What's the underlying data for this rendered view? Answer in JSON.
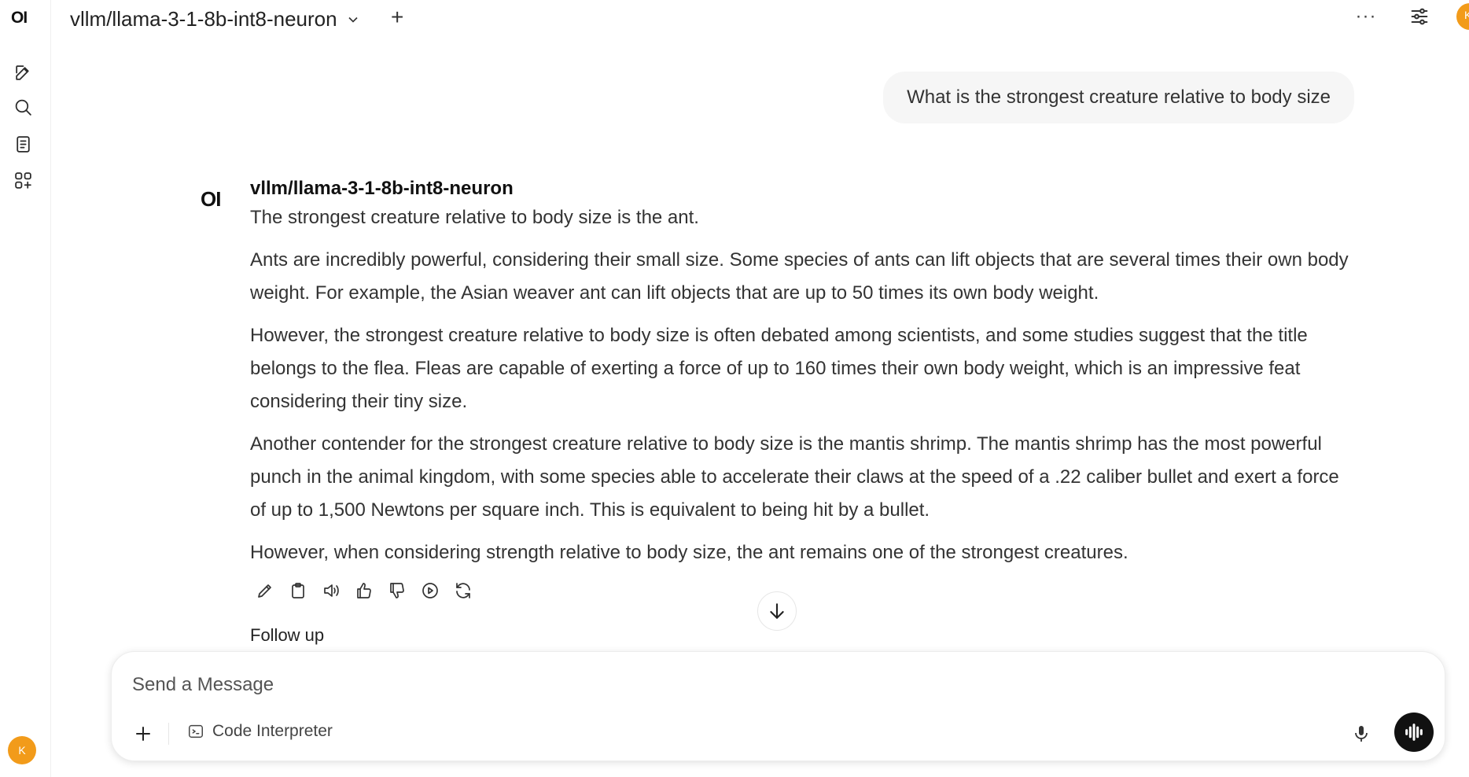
{
  "sidebar": {
    "logo": "OI",
    "user_initial": "K"
  },
  "header": {
    "model_name": "vllm/llama-3-1-8b-int8-neuron",
    "user_initial": "K"
  },
  "chat": {
    "user_message": "What is the strongest creature relative to body size",
    "assistant": {
      "logo": "OI",
      "model_name": "vllm/llama-3-1-8b-int8-neuron",
      "paragraphs": [
        "The strongest creature relative to body size is the ant.",
        "Ants are incredibly powerful, considering their small size. Some species of ants can lift objects that are several times their own body weight. For example, the Asian weaver ant can lift objects that are up to 50 times its own body weight.",
        "However, the strongest creature relative to body size is often debated among scientists, and some studies suggest that the title belongs to the flea. Fleas are capable of exerting a force of up to 160 times their own body weight, which is an impressive feat considering their tiny size.",
        "Another contender for the strongest creature relative to body size is the mantis shrimp. The mantis shrimp has the most powerful punch in the animal kingdom, with some species able to accelerate their claws at the speed of a .22 caliber bullet and exert a force of up to 1,500 Newtons per square inch. This is equivalent to being hit by a bullet.",
        "However, when considering strength relative to body size, the ant remains one of the strongest creatures."
      ]
    },
    "follow_up_label": "Follow up"
  },
  "composer": {
    "placeholder": "Send a Message",
    "code_interpreter_label": "Code Interpreter"
  },
  "colors": {
    "avatar": "#f29b1a",
    "user_bubble": "#f6f6f6",
    "voice_button": "#111111"
  }
}
